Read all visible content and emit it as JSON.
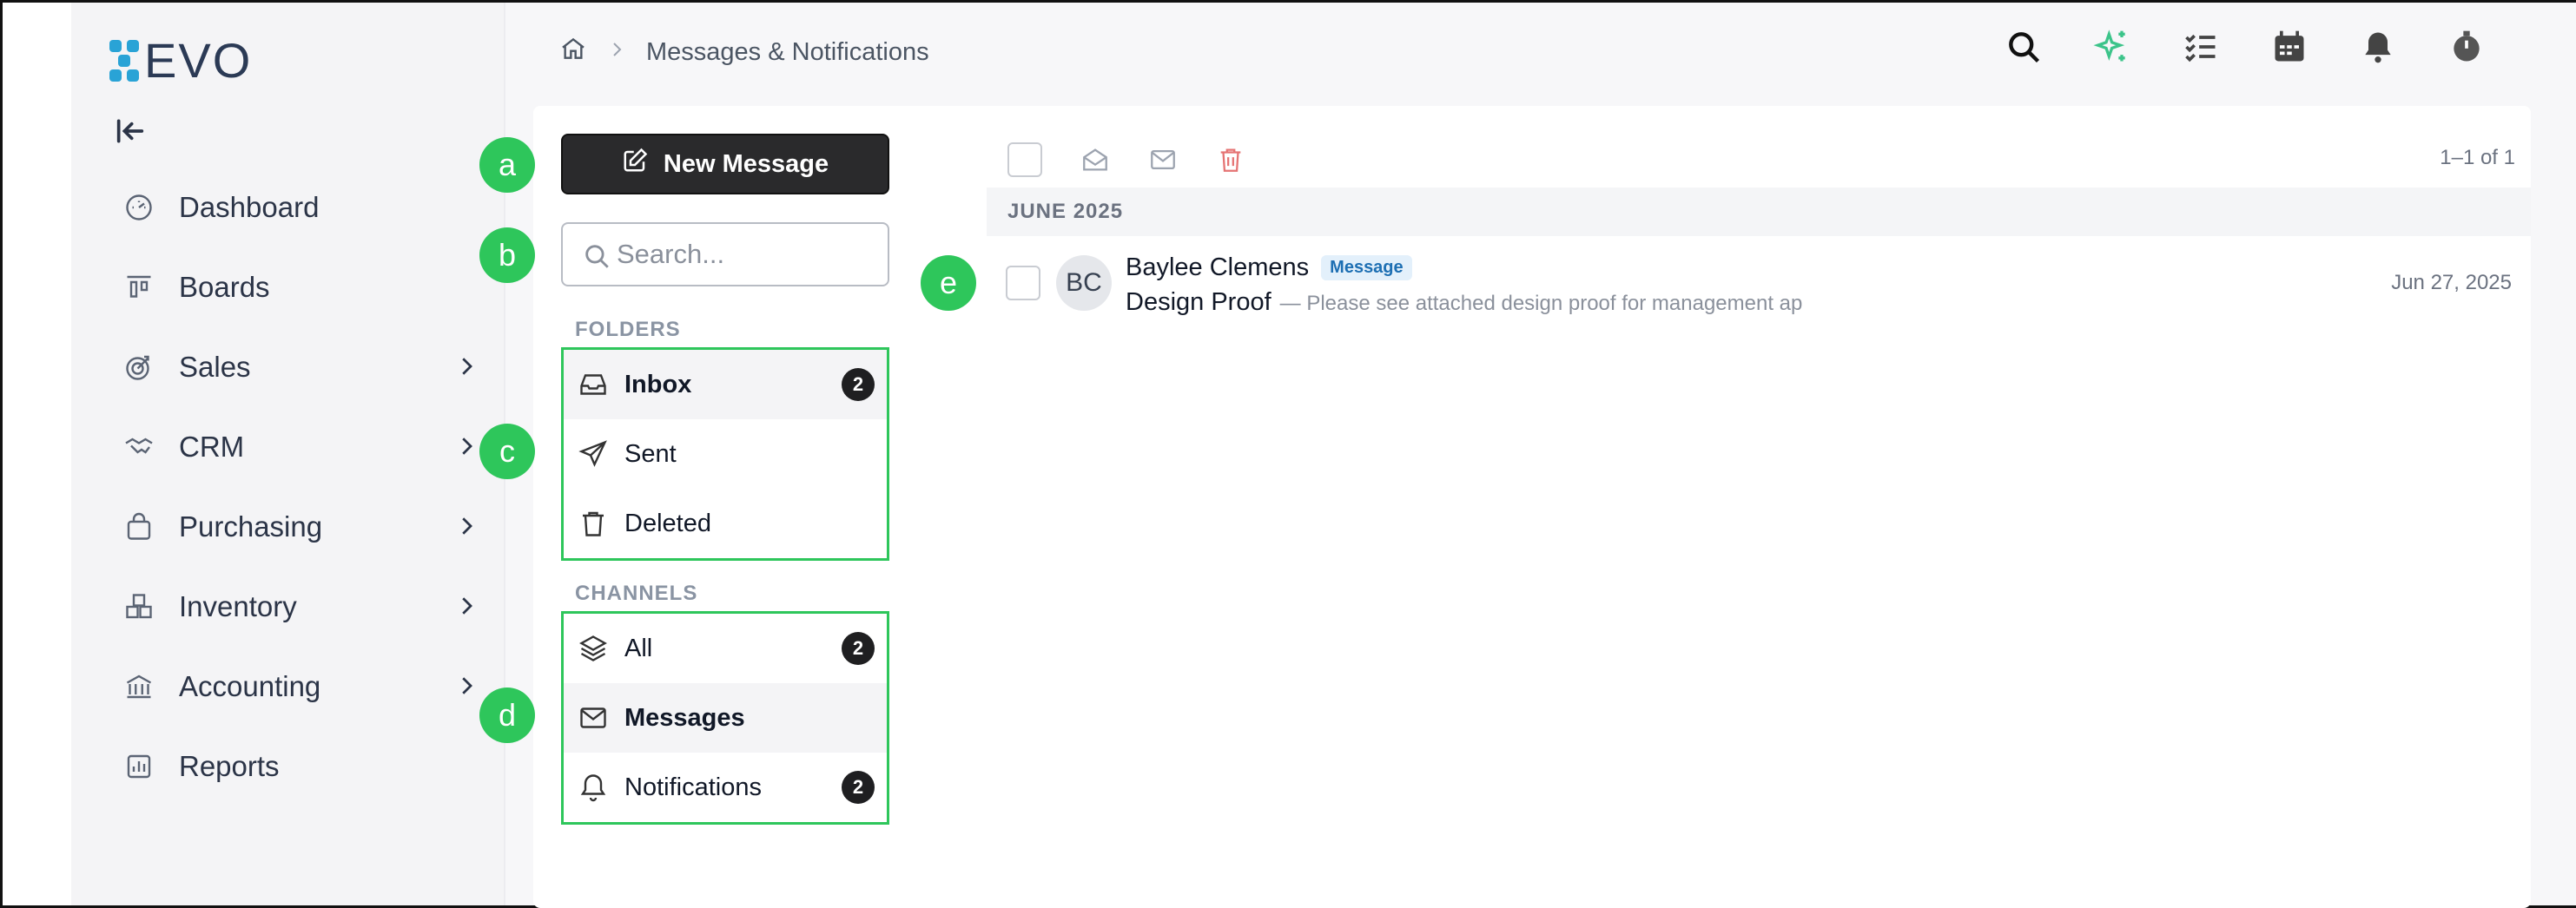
{
  "app": {
    "logo_text": "EVO",
    "brand_color": "#29a3d6"
  },
  "sidebar": {
    "collapse_icon": "collapse-left-icon",
    "items": [
      {
        "label": "Dashboard",
        "icon": "dashboard-icon",
        "has_children": false
      },
      {
        "label": "Boards",
        "icon": "boards-icon",
        "has_children": false
      },
      {
        "label": "Sales",
        "icon": "target-icon",
        "has_children": true
      },
      {
        "label": "CRM",
        "icon": "handshake-icon",
        "has_children": true
      },
      {
        "label": "Purchasing",
        "icon": "bag-icon",
        "has_children": true
      },
      {
        "label": "Inventory",
        "icon": "boxes-icon",
        "has_children": true
      },
      {
        "label": "Accounting",
        "icon": "bank-icon",
        "has_children": true
      },
      {
        "label": "Reports",
        "icon": "report-icon",
        "has_children": false
      }
    ]
  },
  "header": {
    "breadcrumb": {
      "home_icon": "home-icon",
      "current": "Messages & Notifications"
    },
    "icons": [
      "search-icon",
      "sparkle-icon",
      "tasks-icon",
      "calendar-icon",
      "bell-icon",
      "timer-icon"
    ]
  },
  "messages": {
    "new_message_label": "New Message",
    "search_placeholder": "Search...",
    "folders_label": "FOLDERS",
    "folders": [
      {
        "label": "Inbox",
        "count": "2",
        "active": true
      },
      {
        "label": "Sent",
        "count": "",
        "active": false
      },
      {
        "label": "Deleted",
        "count": "",
        "active": false
      }
    ],
    "channels_label": "CHANNELS",
    "channels": [
      {
        "label": "All",
        "count": "2",
        "active": false
      },
      {
        "label": "Messages",
        "count": "",
        "active": true
      },
      {
        "label": "Notifications",
        "count": "2",
        "active": false
      }
    ],
    "pager": "1–1 of 1",
    "month_header": "JUNE 2025",
    "list": [
      {
        "initials": "BC",
        "sender": "Baylee Clemens",
        "tag": "Message",
        "subject": "Design Proof",
        "preview": "— Please see attached design proof for management ap",
        "date": "Jun 27, 2025"
      }
    ]
  },
  "markers": {
    "a": "a",
    "b": "b",
    "c": "c",
    "d": "d",
    "e": "e"
  },
  "colors": {
    "marker": "#2ec65b",
    "badge": "#1f1f21",
    "delete": "#e57373",
    "sparkle": "#3cc48a"
  }
}
